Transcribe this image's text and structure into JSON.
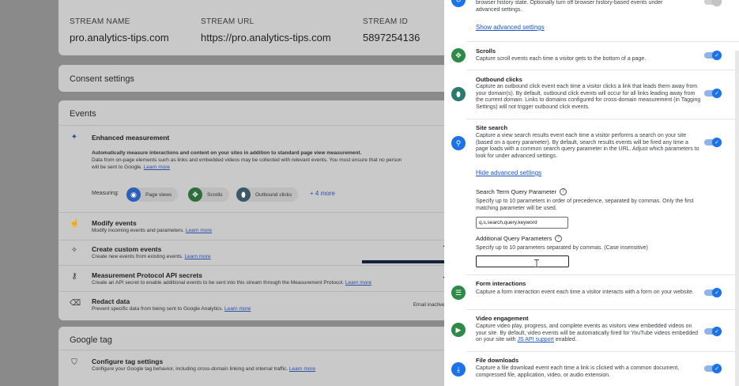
{
  "stream": {
    "name_label": "STREAM NAME",
    "name_value": "pro.analytics-tips.com",
    "url_label": "STREAM URL",
    "url_value": "https://pro.analytics-tips.com",
    "id_label": "STREAM ID",
    "id_value": "5897254136"
  },
  "consent": {
    "title": "Consent settings"
  },
  "events": {
    "title": "Events",
    "enhanced": {
      "title": "Enhanced measurement",
      "desc_bold": "Automatically measure interactions and content on your sites in addition to standard page view measurement.",
      "desc_line2": "Data from on-page elements such as links and embedded videos may be collected with relevant events. You must ensure that no person",
      "desc_line3": "will be sent to Google.",
      "learn_more": "Learn more",
      "measuring_label": "Measuring:",
      "chips": [
        "Page views",
        "Scrolls",
        "Outbound clicks"
      ],
      "more": "+ 4 more"
    },
    "rows": [
      {
        "title": "Modify events",
        "desc": "Modify incoming events and parameters.",
        "link": "Learn more"
      },
      {
        "title": "Create custom events",
        "desc": "Create new events from existing events.",
        "link": "Learn more"
      },
      {
        "title": "Measurement Protocol API secrets",
        "desc": "Create an API secret to enable additional events to be sent into this stream through the Measurement Protocol.",
        "link": "Learn more"
      },
      {
        "title": "Redact data",
        "desc": "Prevent specific data from being sent to Google Analytics.",
        "link": "Learn more",
        "right": "Email inactive  UR"
      }
    ]
  },
  "gtag": {
    "title": "Google tag",
    "configure_title": "Configure tag settings",
    "configure_desc": "Configure your Google tag behavior, including cross-domain linking and internal traffic.",
    "configure_link": "Learn more"
  },
  "panel": {
    "top_desc_line1": "browser history state. Optionally turn off browser history-based events under",
    "top_desc_line2": "advanced settings.",
    "show_advanced": "Show advanced settings",
    "scrolls": {
      "title": "Scrolls",
      "desc": "Capture scroll events each time a visitor gets to the bottom of a page."
    },
    "outbound": {
      "title": "Outbound clicks",
      "desc": "Capture an outbound click event each time a visitor clicks a link that leads them away from your domain(s). By default, outbound click events will occur for all links leading away from the current domain. Links to domains configured for cross-domain measurement (in Tagging Settings) will not trigger outbound click events."
    },
    "site_search": {
      "title": "Site search",
      "desc": "Capture a view search results event each time a visitor performs a search on your site (based on a query parameter). By default, search results events will be fired any time a page loads with a common search query parameter in the URL. Adjust which parameters to look for under advanced settings."
    },
    "hide_advanced": "Hide advanced settings",
    "search_term": {
      "label": "Search Term Query Parameter",
      "desc": "Specify up to 10 parameters in order of precedence, separated by commas. Only the first matching parameter will be used.",
      "value": "q,s,search,query,keyword"
    },
    "additional": {
      "label": "Additional Query Parameters",
      "desc": "Specify up to 10 parameters separated by commas. (Case insensitive)",
      "value": ""
    },
    "form": {
      "title": "Form interactions",
      "desc": "Capture a form interaction event each time a visitor interacts with a form on your website."
    },
    "video": {
      "title": "Video engagement",
      "desc_before": "Capture video play, progress, and complete events as visitors view embedded videos on your site. By default, video events will be automatically fired for YouTube videos embedded on your site with ",
      "desc_link": "JS API support",
      "desc_after": " enabled."
    },
    "downloads": {
      "title": "File downloads",
      "desc": "Capture a file download event each time a link is clicked with a common document, compressed file, application, video, or audio extension."
    }
  },
  "colors": {
    "accent": "#1a73e8",
    "green_icon": "#2e8a47",
    "blue_icon": "#1a73e8",
    "arrow": "#15203a"
  }
}
